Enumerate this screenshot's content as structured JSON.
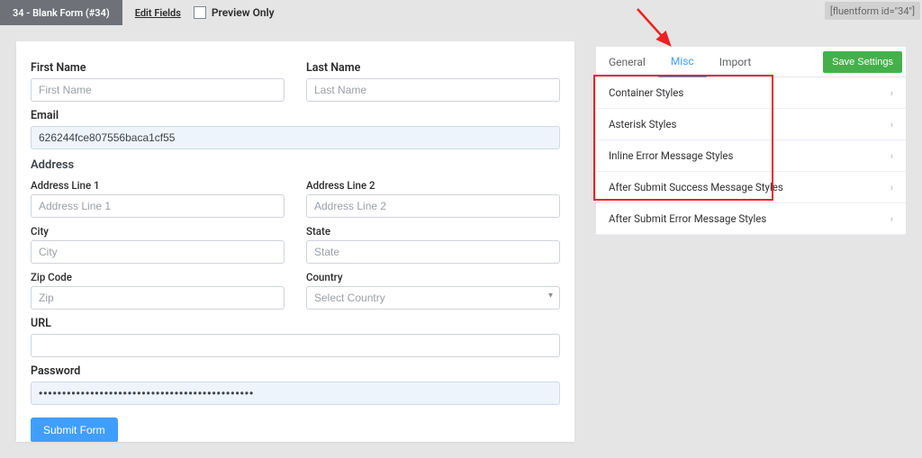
{
  "topbar": {
    "title": "34 - Blank Form (#34)",
    "edit_fields": "Edit Fields",
    "preview_only": "Preview Only",
    "shortcode": "[fluentform id=\"34\"]"
  },
  "form": {
    "first_name": {
      "label": "First Name",
      "placeholder": "First Name"
    },
    "last_name": {
      "label": "Last Name",
      "placeholder": "Last Name"
    },
    "email": {
      "label": "Email",
      "value": "626244fce807556baca1cf55"
    },
    "address_group": "Address",
    "addr1": {
      "label": "Address Line 1",
      "placeholder": "Address Line 1"
    },
    "addr2": {
      "label": "Address Line 2",
      "placeholder": "Address Line 2"
    },
    "city": {
      "label": "City",
      "placeholder": "City"
    },
    "state": {
      "label": "State",
      "placeholder": "State"
    },
    "zip": {
      "label": "Zip Code",
      "placeholder": "Zip"
    },
    "country": {
      "label": "Country",
      "placeholder": "Select Country"
    },
    "url": {
      "label": "URL"
    },
    "password": {
      "label": "Password",
      "value": "••••••••••••••••••••••••••••••••••••••••••••••"
    },
    "submit": "Submit Form"
  },
  "side": {
    "tabs": {
      "general": "General",
      "misc": "Misc",
      "import": "Import"
    },
    "save": "Save Settings",
    "items": [
      "Container Styles",
      "Asterisk Styles",
      "Inline Error Message Styles",
      "After Submit Success Message Styles",
      "After Submit Error Message Styles"
    ]
  }
}
